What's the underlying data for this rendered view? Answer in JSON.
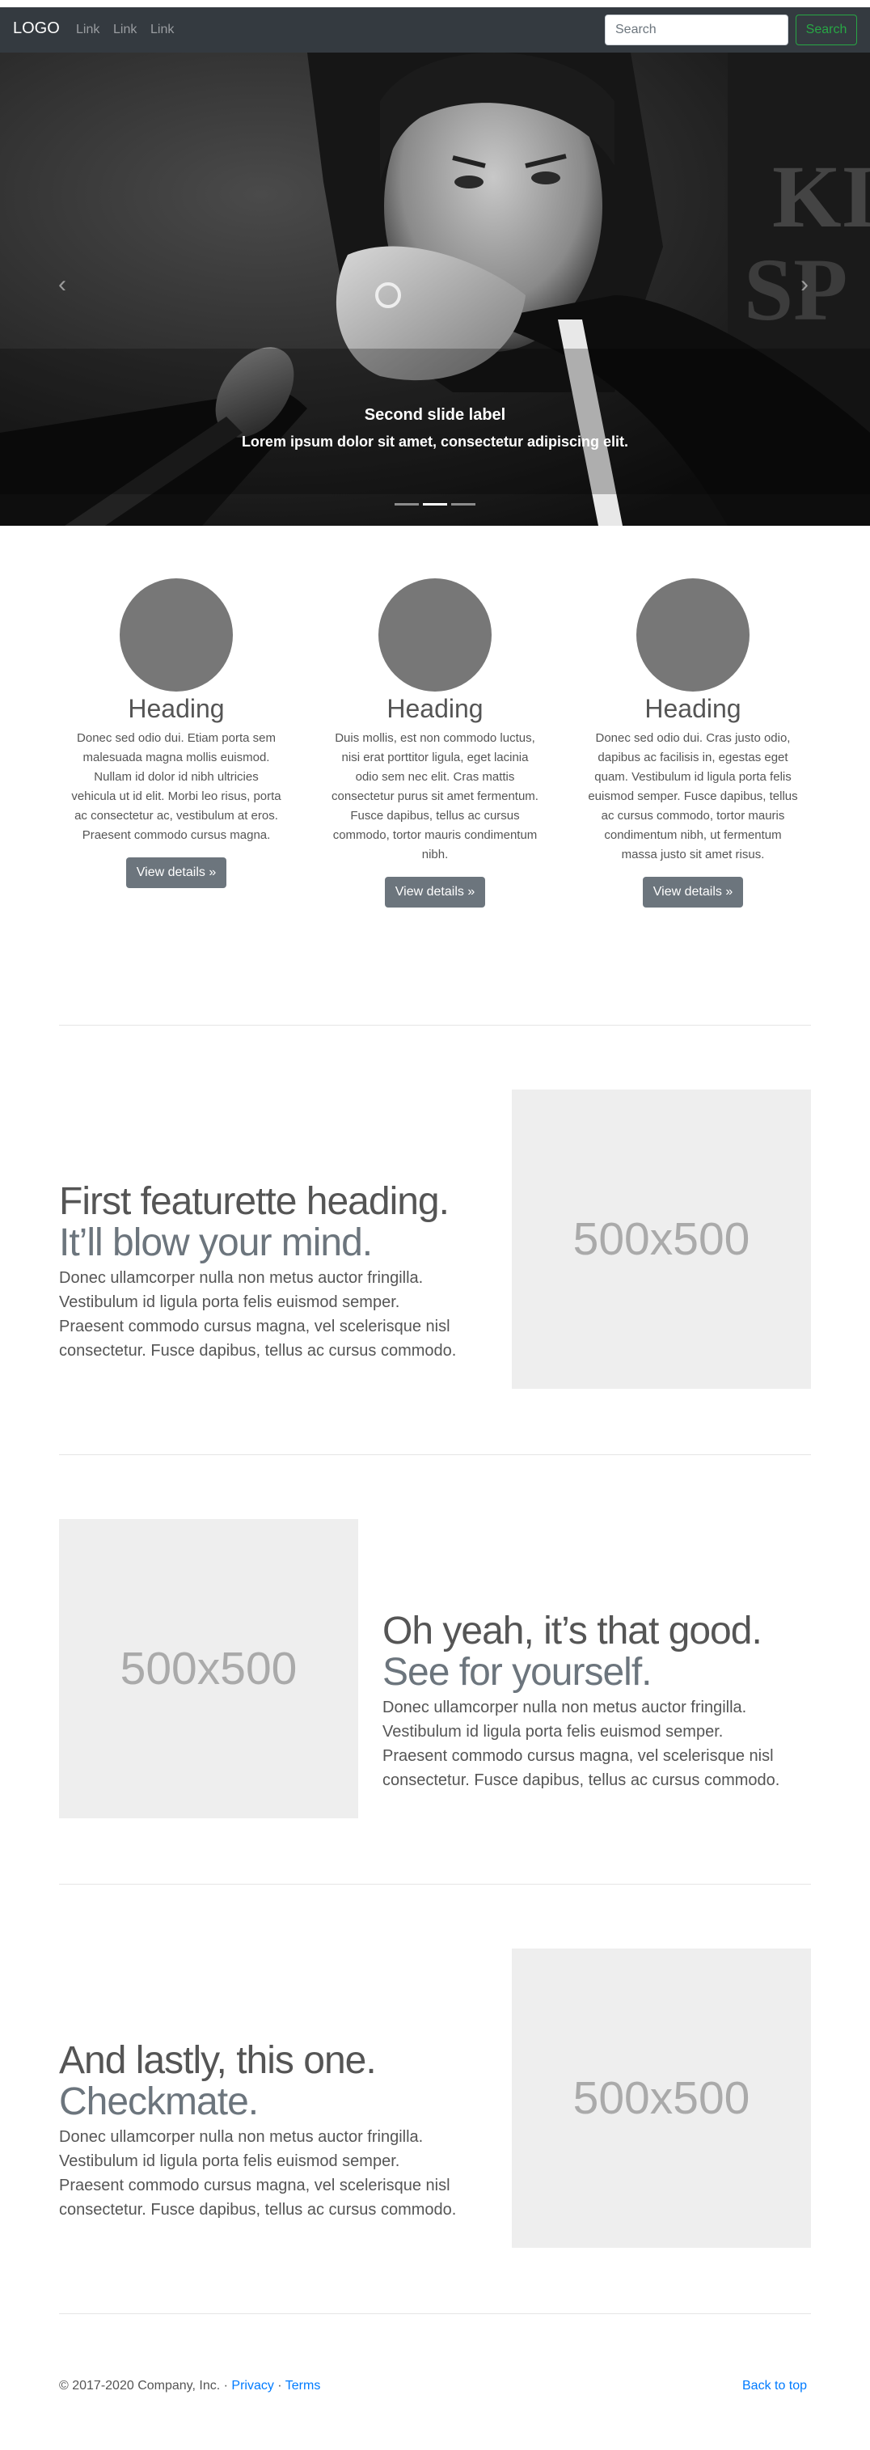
{
  "navbar": {
    "brand": "LOGO",
    "links": [
      "Link",
      "Link",
      "Link"
    ],
    "search_placeholder": "Search",
    "search_button": "Search"
  },
  "carousel": {
    "caption_label": "Second slide label",
    "caption_text": "Lorem ipsum dolor sit amet, consectetur adipiscing elit.",
    "indicators": 3,
    "active_index": 1,
    "prev_glyph": "‹",
    "next_glyph": "›"
  },
  "columns": [
    {
      "heading": "Heading",
      "text": "Donec sed odio dui. Etiam porta sem malesuada magna mollis euismod. Nullam id dolor id nibh ultricies vehicula ut id elit. Morbi leo risus, porta ac consectetur ac, vestibulum at eros. Praesent commodo cursus magna.",
      "button": "View details »"
    },
    {
      "heading": "Heading",
      "text": "Duis mollis, est non commodo luctus, nisi erat porttitor ligula, eget lacinia odio sem nec elit. Cras mattis consectetur purus sit amet fermentum. Fusce dapibus, tellus ac cursus commodo, tortor mauris condimentum nibh.",
      "button": "View details »"
    },
    {
      "heading": "Heading",
      "text": "Donec sed odio dui. Cras justo odio, dapibus ac facilisis in, egestas eget quam. Vestibulum id ligula porta felis euismod semper. Fusce dapibus, tellus ac cursus commodo, tortor mauris condimentum nibh, ut fermentum massa justo sit amet risus.",
      "button": "View details »"
    }
  ],
  "featurettes": [
    {
      "heading": "First featurette heading.",
      "muted": "It’ll blow your mind.",
      "text": "Donec ullamcorper nulla non metus auctor fringilla. Vestibulum id ligula porta felis euismod semper. Praesent commodo cursus magna, vel scelerisque nisl consectetur. Fusce dapibus, tellus ac cursus commodo.",
      "placeholder": "500x500"
    },
    {
      "heading": "Oh yeah, it’s that good.",
      "muted": "See for yourself.",
      "text": "Donec ullamcorper nulla non metus auctor fringilla. Vestibulum id ligula porta felis euismod semper. Praesent commodo cursus magna, vel scelerisque nisl consectetur. Fusce dapibus, tellus ac cursus commodo.",
      "placeholder": "500x500"
    },
    {
      "heading": "And lastly, this one.",
      "muted": "Checkmate.",
      "text": "Donec ullamcorper nulla non metus auctor fringilla. Vestibulum id ligula porta felis euismod semper. Praesent commodo cursus magna, vel scelerisque nisl consectetur. Fusce dapibus, tellus ac cursus commodo.",
      "placeholder": "500x500"
    }
  ],
  "footer": {
    "copyright": "© 2017-2020 Company, Inc. · ",
    "privacy": "Privacy",
    "separator": " · ",
    "terms": "Terms",
    "back_to_top": "Back to top"
  },
  "colors": {
    "navbar_bg": "#343a40",
    "success": "#28a745",
    "secondary": "#6c757d",
    "link": "#007bff"
  }
}
